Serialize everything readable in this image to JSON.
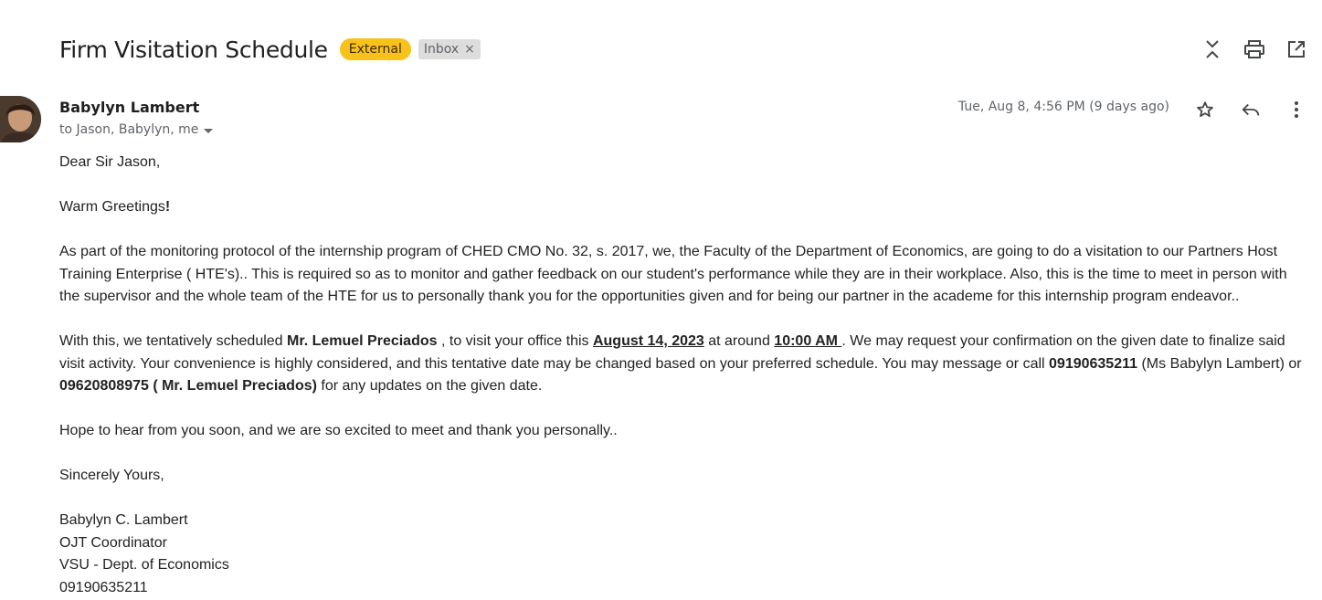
{
  "header": {
    "subject": "Firm Visitation Schedule",
    "badge_external": "External",
    "badge_inbox": "Inbox",
    "badge_inbox_remove": "×",
    "actions": {
      "collapse_icon": "unfold-less-icon",
      "print_icon": "print-icon",
      "open_new_window_icon": "open-in-new-icon"
    }
  },
  "message": {
    "sender_name": "Babylyn Lambert",
    "recipients": "to Jason, Babylyn, me",
    "date": "Tue, Aug 8, 4:56 PM (9 days ago)",
    "actions": {
      "star_icon": "star-icon",
      "reply_icon": "reply-icon",
      "more_icon": "more-vert-icon"
    }
  },
  "body": {
    "greeting": "Dear Sir Jason,",
    "warm": "Warm Greetings",
    "warm_bang": "!",
    "para1": "As part of the monitoring protocol of the internship program of CHED CMO No. 32, s. 2017, we, the Faculty of the Department of Economics, are going to do a visitation to our Partners Host Training Enterprise ( HTE's).. This is required so as to monitor and gather feedback on our student's performance while they are in their workplace. Also, this is the time to meet in person with the supervisor and the whole team of the HTE  for us to personally thank you for the opportunities given and for being our partner in the academe for this internship program endeavor..",
    "para2_a": "With this, we tentatively scheduled  ",
    "para2_name": "Mr. Lemuel Preciados",
    "para2_b": "  , to visit your office this ",
    "para2_date": "August 14, 2023",
    "para2_c": "  at around  ",
    "para2_time": "10:00 AM ",
    "para2_d": ". We may request your confirmation on the given date to finalize said visit activity. Your convenience is highly considered, and this tentative date may be changed based on your preferred schedule. You may message or call ",
    "para2_phone1": "09190635211",
    "para2_e": " (Ms Babylyn Lambert) or  ",
    "para2_phone2": "09620808975 ( Mr. Lemuel Preciados)",
    "para2_f": " for any updates on the given date.",
    "para3": "Hope to hear from you soon, and we are so excited to meet and thank you personally..",
    "closing": "Sincerely Yours,",
    "sig_name": "Babylyn C. Lambert",
    "sig_title": "OJT Coordinator",
    "sig_dept": "VSU - Dept. of Economics",
    "sig_phone": "09190635211"
  },
  "colors": {
    "external_badge": "#f9c21b",
    "inbox_badge": "#dddddd",
    "icon": "#444746",
    "secondary_text": "#5f6368"
  }
}
